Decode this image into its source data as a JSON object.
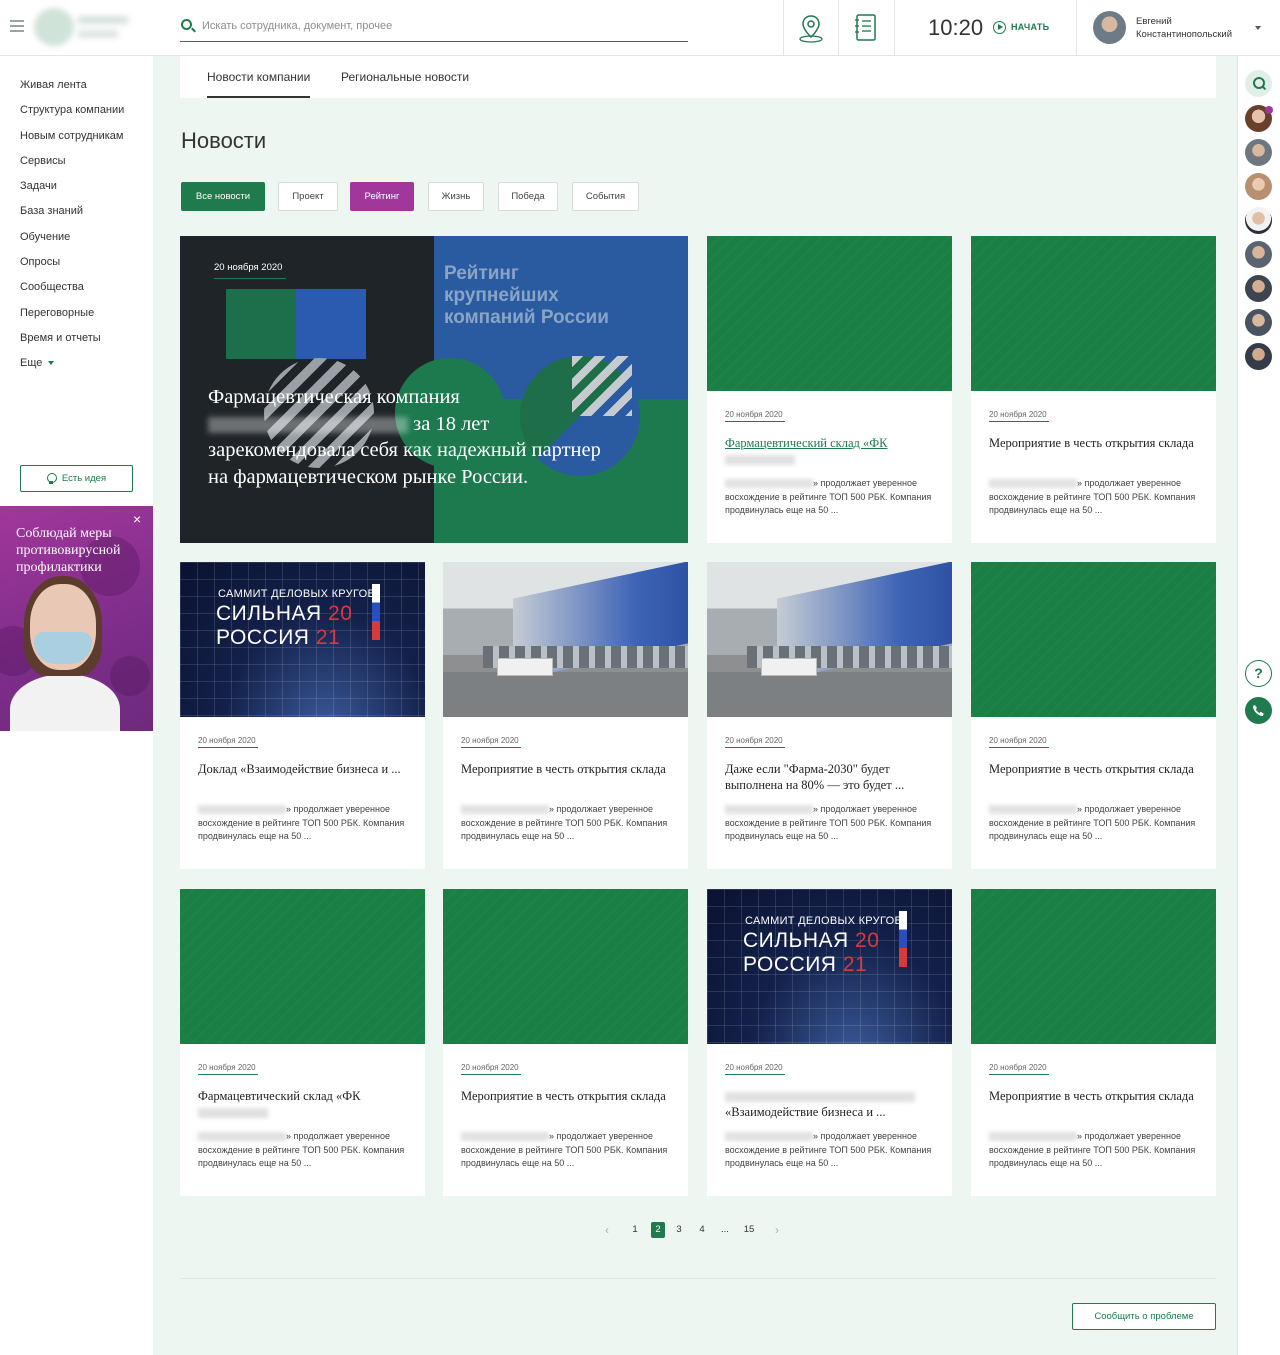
{
  "header": {
    "search_placeholder": "Искать сотрудника, документ, прочее",
    "time": "10:20",
    "start_label": "НАЧАТЬ",
    "user_name_line1": "Евгений",
    "user_name_line2": "Константинопольский"
  },
  "sidebar": {
    "items": [
      {
        "label": "Живая лента"
      },
      {
        "label": "Структура компании"
      },
      {
        "label": "Новым сотрудникам"
      },
      {
        "label": "Сервисы"
      },
      {
        "label": "Задачи"
      },
      {
        "label": "База знаний"
      },
      {
        "label": "Обучение"
      },
      {
        "label": "Опросы"
      },
      {
        "label": "Сообщества"
      },
      {
        "label": "Переговорные"
      },
      {
        "label": "Время и отчеты"
      }
    ],
    "more_label": "Еще",
    "idea_button": "Есть идея",
    "promo_text": "Соблюдай меры противовирусной профилактики",
    "promo_close": "×"
  },
  "tabs": [
    {
      "label": "Новости компании",
      "active": true
    },
    {
      "label": "Региональные новости",
      "active": false
    }
  ],
  "page_title": "Новости",
  "filters": [
    {
      "label": "Все новости"
    },
    {
      "label": "Проект"
    },
    {
      "label": "Рейтинг"
    },
    {
      "label": "Жизнь"
    },
    {
      "label": "Победа"
    },
    {
      "label": "События"
    }
  ],
  "featured": {
    "date": "20 ноября 2020",
    "image_title_line1": "Рейтинг",
    "image_title_line2": "крупнейших",
    "image_title_line3": "компаний России",
    "text_line1": "Фармацевтическая компания",
    "text_line2_suffix": " за 18 лет",
    "text_rest": "зарекомендовала себя как надежный партнер на фармацевтическом рынке России."
  },
  "cards": [
    {
      "date": "20 ноября 2020",
      "title": "Фармацевтический склад «ФК",
      "excerpt_tail": "» продолжает уверенное восхождение в рейтинге ТОП 500 РБК. Компания продвинулась еще на 50 ..."
    },
    {
      "date": "20 ноября 2020",
      "title": "Мероприятие в честь открытия склада",
      "excerpt_tail": "» продолжает уверенное восхождение в рейтинге ТОП 500 РБК. Компания продвинулась еще на 50 ..."
    },
    {
      "date": "20 ноября 2020",
      "title": "Доклад «Взаимодействие бизнеса и ...",
      "excerpt_tail": "» продолжает уверенное восхождение в рейтинге ТОП 500 РБК. Компания продвинулась еще на 50 ...",
      "img_line1": "САММИТ ДЕЛОВЫХ КРУГОВ",
      "img_line2a": "СИЛЬНАЯ",
      "img_line2b": "20",
      "img_line3a": "РОССИЯ",
      "img_line3b": "21"
    },
    {
      "date": "20 ноября 2020",
      "title": "Мероприятие в честь открытия склада",
      "excerpt_tail": "» продолжает уверенное восхождение в рейтинге ТОП 500 РБК. Компания продвинулась еще на 50 ..."
    },
    {
      "date": "20 ноября 2020",
      "title": "Даже если \"Фарма-2030\" будет выполнена на 80% — это будет ...",
      "excerpt_tail": "» продолжает уверенное восхождение в рейтинге ТОП 500 РБК. Компания продвинулась еще на 50 ..."
    },
    {
      "date": "20 ноября 2020",
      "title": "Мероприятие в честь открытия склада",
      "excerpt_tail": "» продолжает уверенное восхождение в рейтинге ТОП 500 РБК. Компания продвинулась еще на 50 ..."
    },
    {
      "date": "20 ноября 2020",
      "title": "Фармацевтический склад «ФК",
      "excerpt_tail": "» продолжает уверенное восхождение в рейтинге ТОП 500 РБК. Компания продвинулась еще на 50 ..."
    },
    {
      "date": "20 ноября 2020",
      "title": "Мероприятие в честь открытия склада",
      "excerpt_tail": "» продолжает уверенное восхождение в рейтинге ТОП 500 РБК. Компания продвинулась еще на 50 ..."
    },
    {
      "date": "20 ноября 2020",
      "title": "«Взаимодействие бизнеса и ...",
      "excerpt_tail": "» продолжает уверенное восхождение в рейтинге ТОП 500 РБК. Компания продвинулась еще на 50 ...",
      "img_line1": "САММИТ ДЕЛОВЫХ КРУГОВ",
      "img_line2a": "СИЛЬНАЯ",
      "img_line2b": "20",
      "img_line3a": "РОССИЯ",
      "img_line3b": "21"
    },
    {
      "date": "20 ноября 2020",
      "title": "Мероприятие в честь открытия склада",
      "excerpt_tail": "» продолжает уверенное восхождение в рейтинге ТОП 500 РБК. Компания продвинулась еще на 50 ..."
    }
  ],
  "pagination": {
    "prev": "‹",
    "pages": [
      "1",
      "2",
      "3",
      "4",
      "...",
      "15"
    ],
    "active_page": "2",
    "next": "›"
  },
  "footer": {
    "report_button": "Сообщить о проблеме"
  },
  "colors": {
    "accent": "#1f7a4d",
    "highlight": "#a1379b",
    "background": "#eef6f1"
  }
}
